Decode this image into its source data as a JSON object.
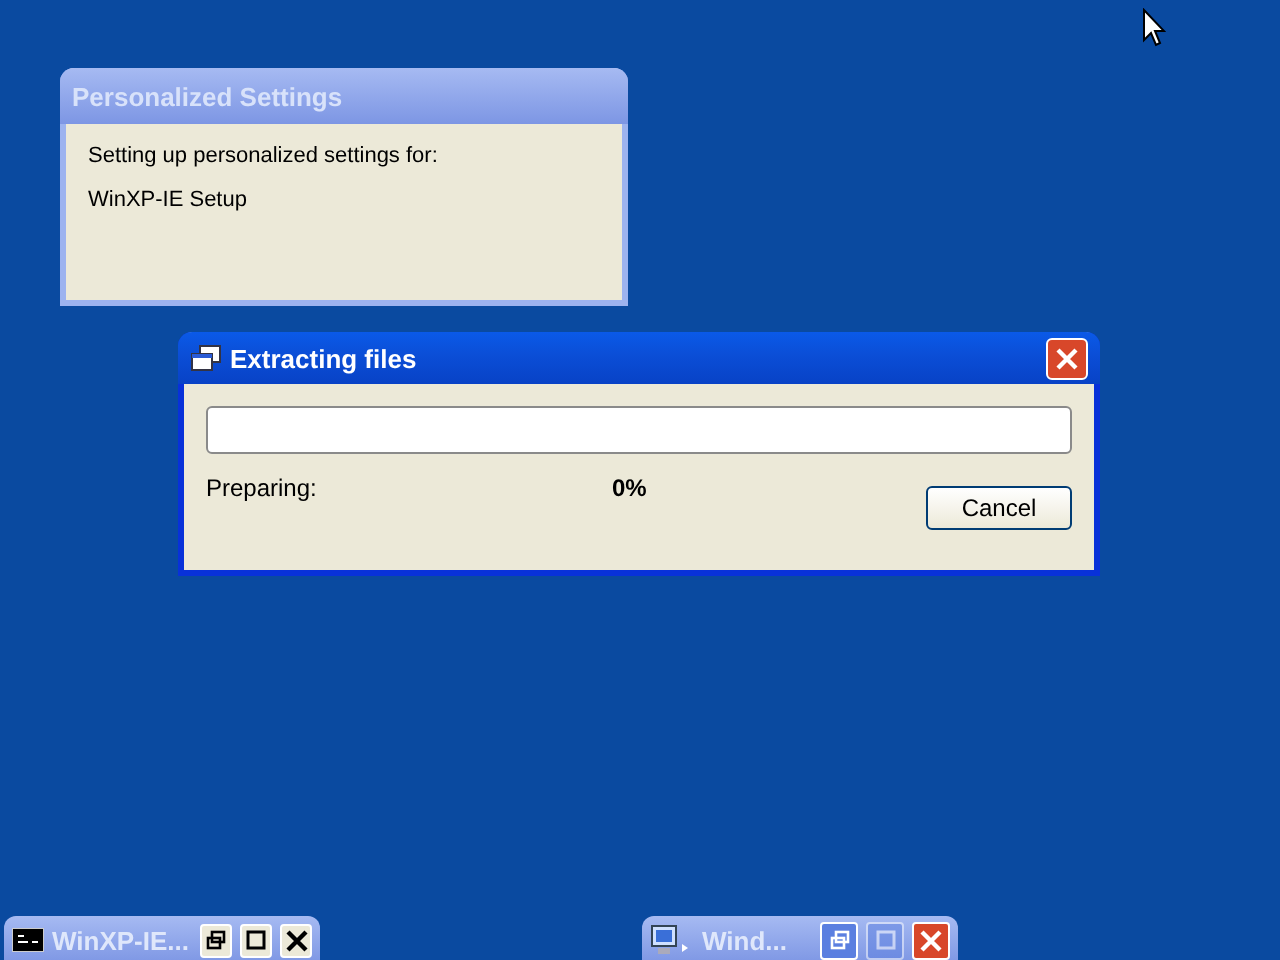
{
  "windows": [
    {
      "kind": "info",
      "active": false,
      "title": "Personalized Settings",
      "lines": [
        "Setting up personalized settings for:",
        "WinXP-IE Setup"
      ]
    },
    {
      "kind": "progress",
      "active": true,
      "title": "Extracting files",
      "progress": {
        "level": 0
      },
      "status": "Preparing:",
      "percent": "0%",
      "buttons": [
        "Cancel"
      ]
    }
  ],
  "minimized": [
    {
      "kind": "console",
      "title": "WinXP-IE...",
      "controls": [
        {
          "kind": "restore",
          "disabled": false
        },
        {
          "kind": "maximize",
          "disabled": false
        },
        {
          "kind": "close",
          "disabled": false
        }
      ]
    },
    {
      "kind": "explorer",
      "title": "Wind...",
      "controls": [
        {
          "kind": "restore",
          "disabled": false
        },
        {
          "kind": "maximize",
          "disabled": true
        },
        {
          "kind": "close",
          "disabled": false
        }
      ]
    }
  ]
}
